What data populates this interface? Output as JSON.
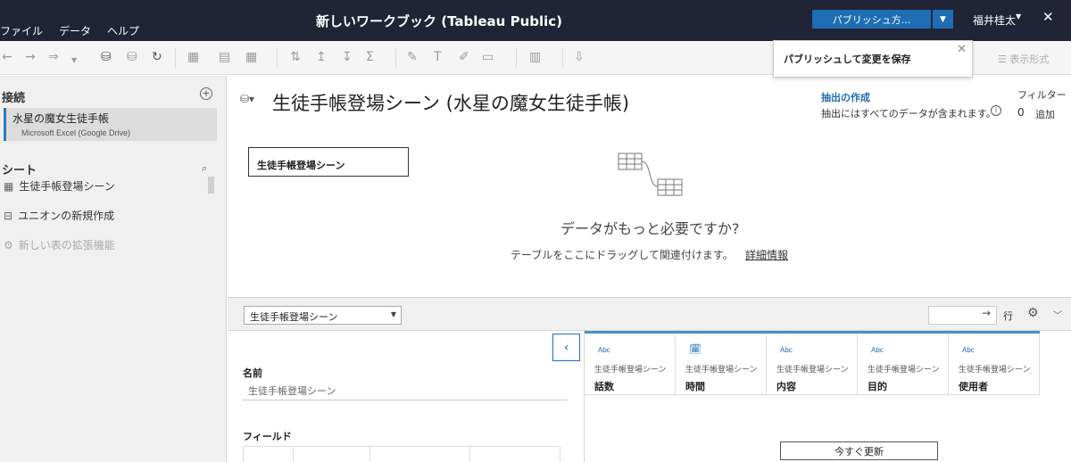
{
  "titlebar": {
    "menu": [
      "ファイル",
      "データ",
      "ヘルプ"
    ],
    "workbook_title": "新しいワークブック (Tableau Public)",
    "publish_label": "パブリッシュ方...",
    "user_name": "福井桂太",
    "close_glyph": "✕"
  },
  "toolbar": {
    "display_format": "表示形式"
  },
  "popup": {
    "text": "パブリッシュして変更を保存"
  },
  "left_panel": {
    "connections_heading": "接続",
    "connection": {
      "name": "水星の魔女生徒手帳",
      "type": "Microsoft Excel (Google Drive)"
    },
    "sheets_heading": "シート",
    "items": [
      {
        "label": "生徒手帳登場シーン"
      },
      {
        "label": "ユニオンの新規作成"
      },
      {
        "label": "新しい表の拡張機能"
      }
    ]
  },
  "canvas": {
    "datasource_title": "生徒手帳登場シーン (水星の魔女生徒手帳)",
    "extract_link": "抽出の作成",
    "extract_desc": "抽出にはすべてのデータが含まれます。",
    "filter_label": "フィルター",
    "filter_count": "0",
    "filter_add": "追加",
    "table_chip": "生徒手帳登場シーン",
    "need_more": "データがもっと必要ですか?",
    "drag_hint": "テーブルをここにドラッグして関連付けます。",
    "detail_link": "詳細情報"
  },
  "lower_bar": {
    "selected_table": "生徒手帳登場シーン",
    "rows_label": "行"
  },
  "form": {
    "name_label": "名前",
    "name_value": "生徒手帳登場シーン",
    "fields_label": "フィールド"
  },
  "grid": {
    "columns": [
      {
        "type": "Abc",
        "source": "生徒手帳登場シーン",
        "name": "話数"
      },
      {
        "type": "date",
        "source": "生徒手帳登場シーン",
        "name": "時間"
      },
      {
        "type": "Abc",
        "source": "生徒手帳登場シーン",
        "name": "内容"
      },
      {
        "type": "Abc",
        "source": "生徒手帳登場シーン",
        "name": "目的"
      },
      {
        "type": "Abc",
        "source": "生徒手帳登場シーン",
        "name": "使用者"
      }
    ],
    "refresh_label": "今すぐ更新"
  },
  "colors": {
    "titlebar_bg": "#1f2437",
    "accent": "#1f6db3",
    "grid_header_top": "#4a90c9"
  }
}
